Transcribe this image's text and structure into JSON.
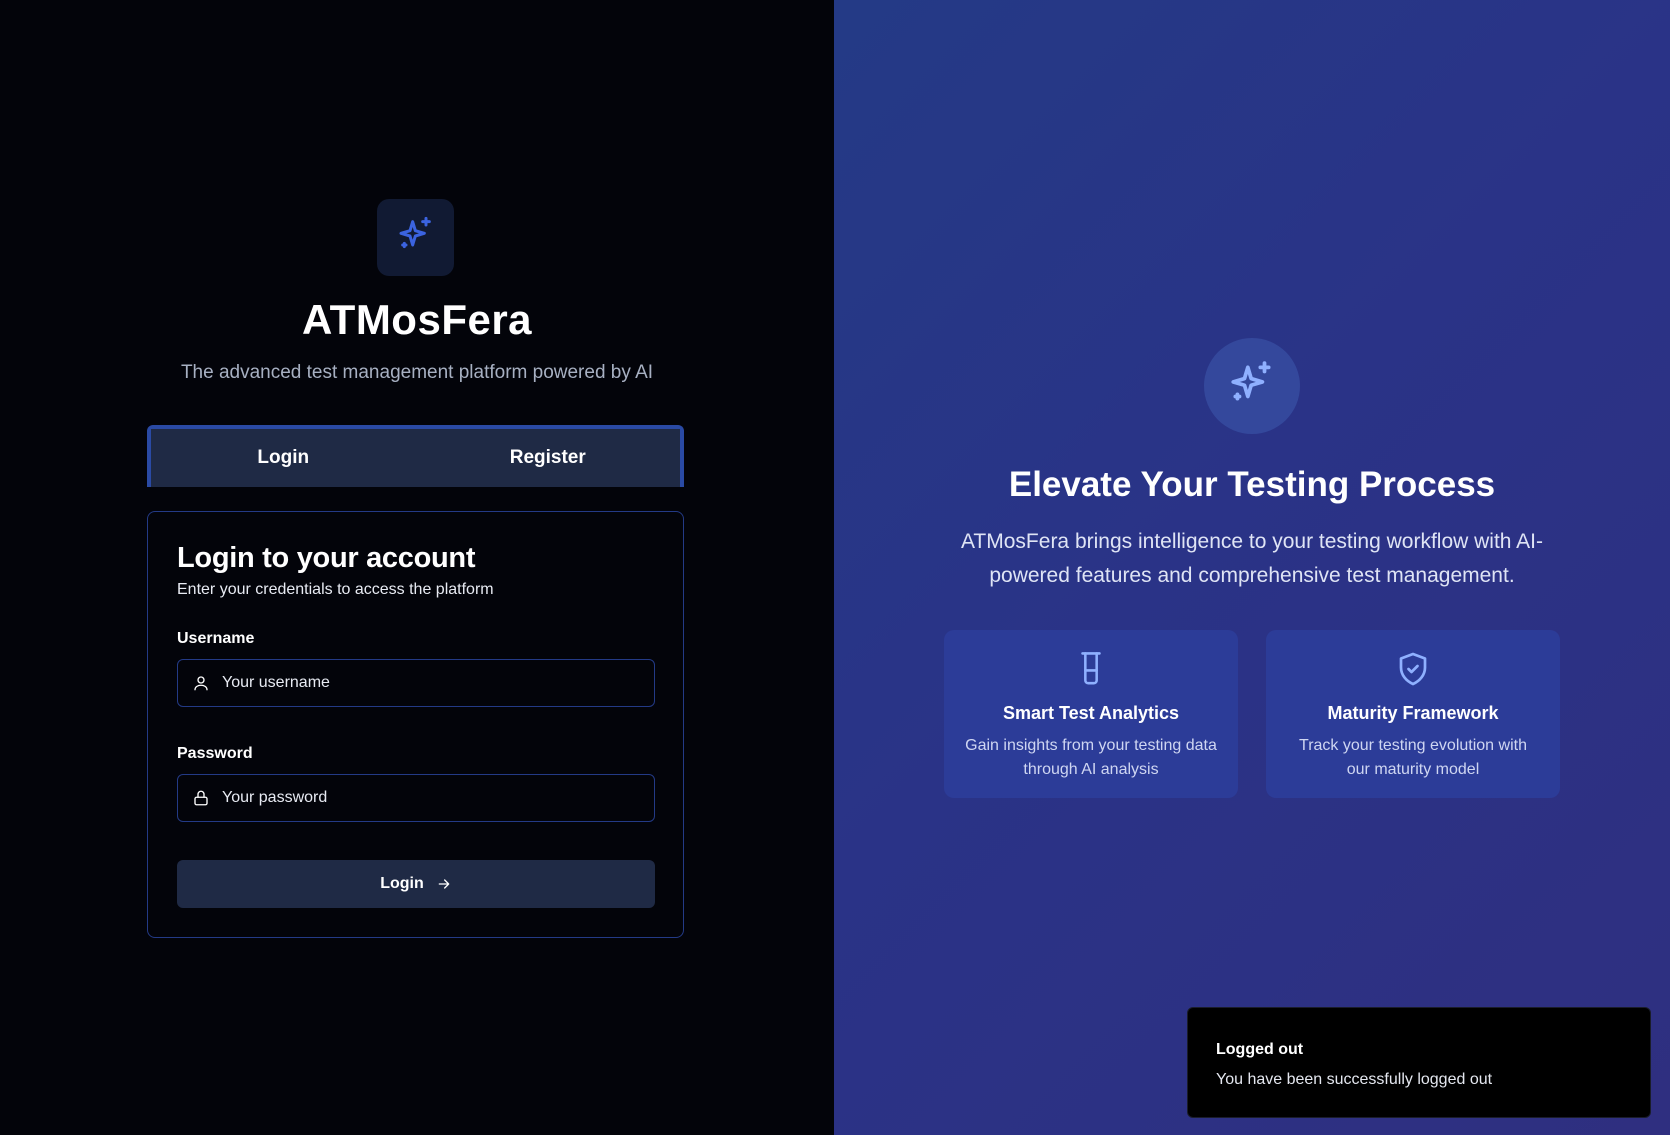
{
  "brand": {
    "name": "ATMosFera",
    "tagline": "The advanced test management platform powered by AI",
    "logo_icon": "sparkles-icon",
    "accent": "#3b63e0"
  },
  "tabs": [
    {
      "label": "Login",
      "active": true
    },
    {
      "label": "Register",
      "active": false
    }
  ],
  "login_card": {
    "title": "Login to your account",
    "description": "Enter your credentials to access the platform",
    "username": {
      "label": "Username",
      "placeholder": "Your username",
      "value": "",
      "icon": "user-icon"
    },
    "password": {
      "label": "Password",
      "placeholder": "Your password",
      "value": "",
      "icon": "lock-icon"
    },
    "submit_label": "Login",
    "submit_icon": "arrow-right-icon"
  },
  "hero": {
    "icon": "sparkles-icon",
    "title": "Elevate Your Testing Process",
    "description": "ATMosFera brings intelligence to your testing workflow with AI-powered features and comprehensive test management."
  },
  "features": [
    {
      "icon": "beaker-icon",
      "title": "Smart Test Analytics",
      "description": "Gain insights from your testing data through AI analysis"
    },
    {
      "icon": "shield-check-icon",
      "title": "Maturity Framework",
      "description": "Track your testing evolution with our maturity model"
    }
  ],
  "toast": {
    "title": "Logged out",
    "message": "You have been successfully logged out"
  }
}
